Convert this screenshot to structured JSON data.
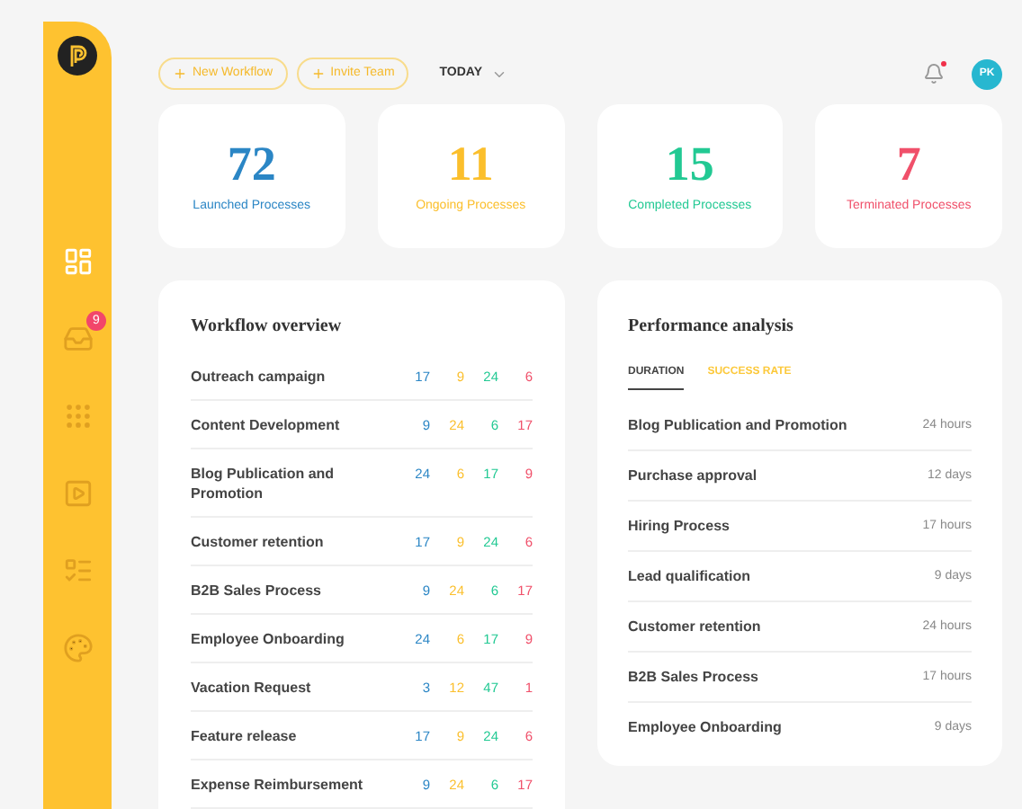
{
  "sidebar": {
    "items": [
      {
        "selected": true
      },
      {
        "selected": false,
        "badge": "9"
      },
      {
        "selected": false
      },
      {
        "selected": false
      },
      {
        "selected": false
      },
      {
        "selected": false
      }
    ]
  },
  "toolbar": {
    "buttons": [
      "New Workflow",
      "Invite Team"
    ],
    "period": "TODAY",
    "notification": true,
    "avatar": "PK"
  },
  "stats": [
    {
      "value": "72",
      "label": "Launched Processes",
      "color": "#2b86c5"
    },
    {
      "value": "11",
      "label": "Ongoing Processes",
      "color": "#fbbf2c"
    },
    {
      "value": "15",
      "label": "Completed Processes",
      "color": "#22c993"
    },
    {
      "value": "7",
      "label": "Terminated Processes",
      "color": "#f0506a"
    }
  ],
  "workflow_overview": {
    "title": "Workflow overview",
    "rows": [
      {
        "name": "Outreach campaign",
        "values": [
          "17",
          "9",
          "24",
          "6"
        ]
      },
      {
        "name": "Content Development",
        "values": [
          "9",
          "24",
          "6",
          "17"
        ]
      },
      {
        "name": "Blog Publication and Promotion",
        "values": [
          "24",
          "6",
          "17",
          "9"
        ]
      },
      {
        "name": "Customer retention",
        "values": [
          "17",
          "9",
          "24",
          "6"
        ]
      },
      {
        "name": "B2B Sales Process",
        "values": [
          "9",
          "24",
          "6",
          "17"
        ]
      },
      {
        "name": "Employee Onboarding",
        "values": [
          "24",
          "6",
          "17",
          "9"
        ]
      },
      {
        "name": "Vacation Request",
        "values": [
          "3",
          "12",
          "47",
          "1"
        ]
      },
      {
        "name": "Feature release",
        "values": [
          "17",
          "9",
          "24",
          "6"
        ]
      },
      {
        "name": "Expense Reimbursement",
        "values": [
          "9",
          "24",
          "6",
          "17"
        ]
      }
    ]
  },
  "performance_analysis": {
    "title": "Performance analysis",
    "tabs": [
      {
        "label": "DURATION",
        "selected": true
      },
      {
        "label": "SUCCESS RATE",
        "selected": false
      }
    ],
    "rows": [
      {
        "name": "Blog Publication and Promotion",
        "value": "24 hours"
      },
      {
        "name": "Purchase approval",
        "value": "12 days"
      },
      {
        "name": "Hiring Process",
        "value": "17 hours"
      },
      {
        "name": "Lead qualification",
        "value": "9 days"
      },
      {
        "name": "Customer retention",
        "value": "24 hours"
      },
      {
        "name": "B2B Sales Process",
        "value": "17 hours"
      },
      {
        "name": "Employee Onboarding",
        "value": "9 days"
      }
    ]
  }
}
